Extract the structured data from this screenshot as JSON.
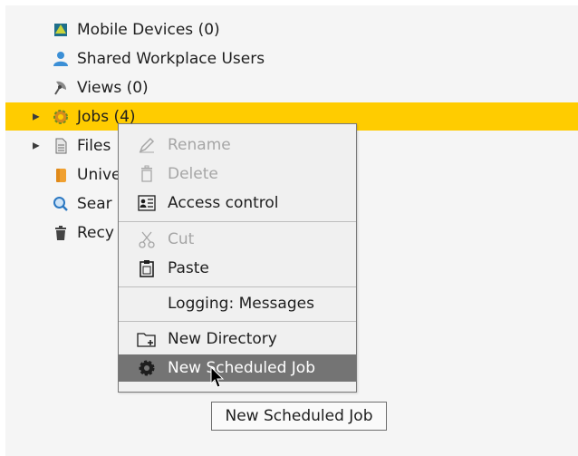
{
  "tree": {
    "items": [
      {
        "label": "Mobile Devices (0)",
        "icon": "mobile-devices-icon"
      },
      {
        "label": "Shared Workplace Users",
        "icon": "user-icon"
      },
      {
        "label": "Views (0)",
        "icon": "views-icon"
      },
      {
        "label": "Jobs (4)",
        "icon": "jobs-gear-icon",
        "expand": "▶",
        "selected": true
      },
      {
        "label": "Files",
        "icon": "file-icon",
        "expand": "▶"
      },
      {
        "label": "Unive",
        "icon": "universe-icon"
      },
      {
        "label": "Sear",
        "icon": "search-icon"
      },
      {
        "label": "Recy",
        "icon": "recycle-bin-icon"
      }
    ]
  },
  "context_menu": {
    "rename": "Rename",
    "delete": "Delete",
    "access_control": "Access control",
    "cut": "Cut",
    "paste": "Paste",
    "logging": "Logging: Messages",
    "new_directory": "New Directory",
    "new_scheduled_job": "New Scheduled Job"
  },
  "tooltip": {
    "text": "New Scheduled Job"
  },
  "colors": {
    "selection": "#ffcc00",
    "menu_hover": "#747474",
    "disabled_text": "#a6a6a6"
  }
}
